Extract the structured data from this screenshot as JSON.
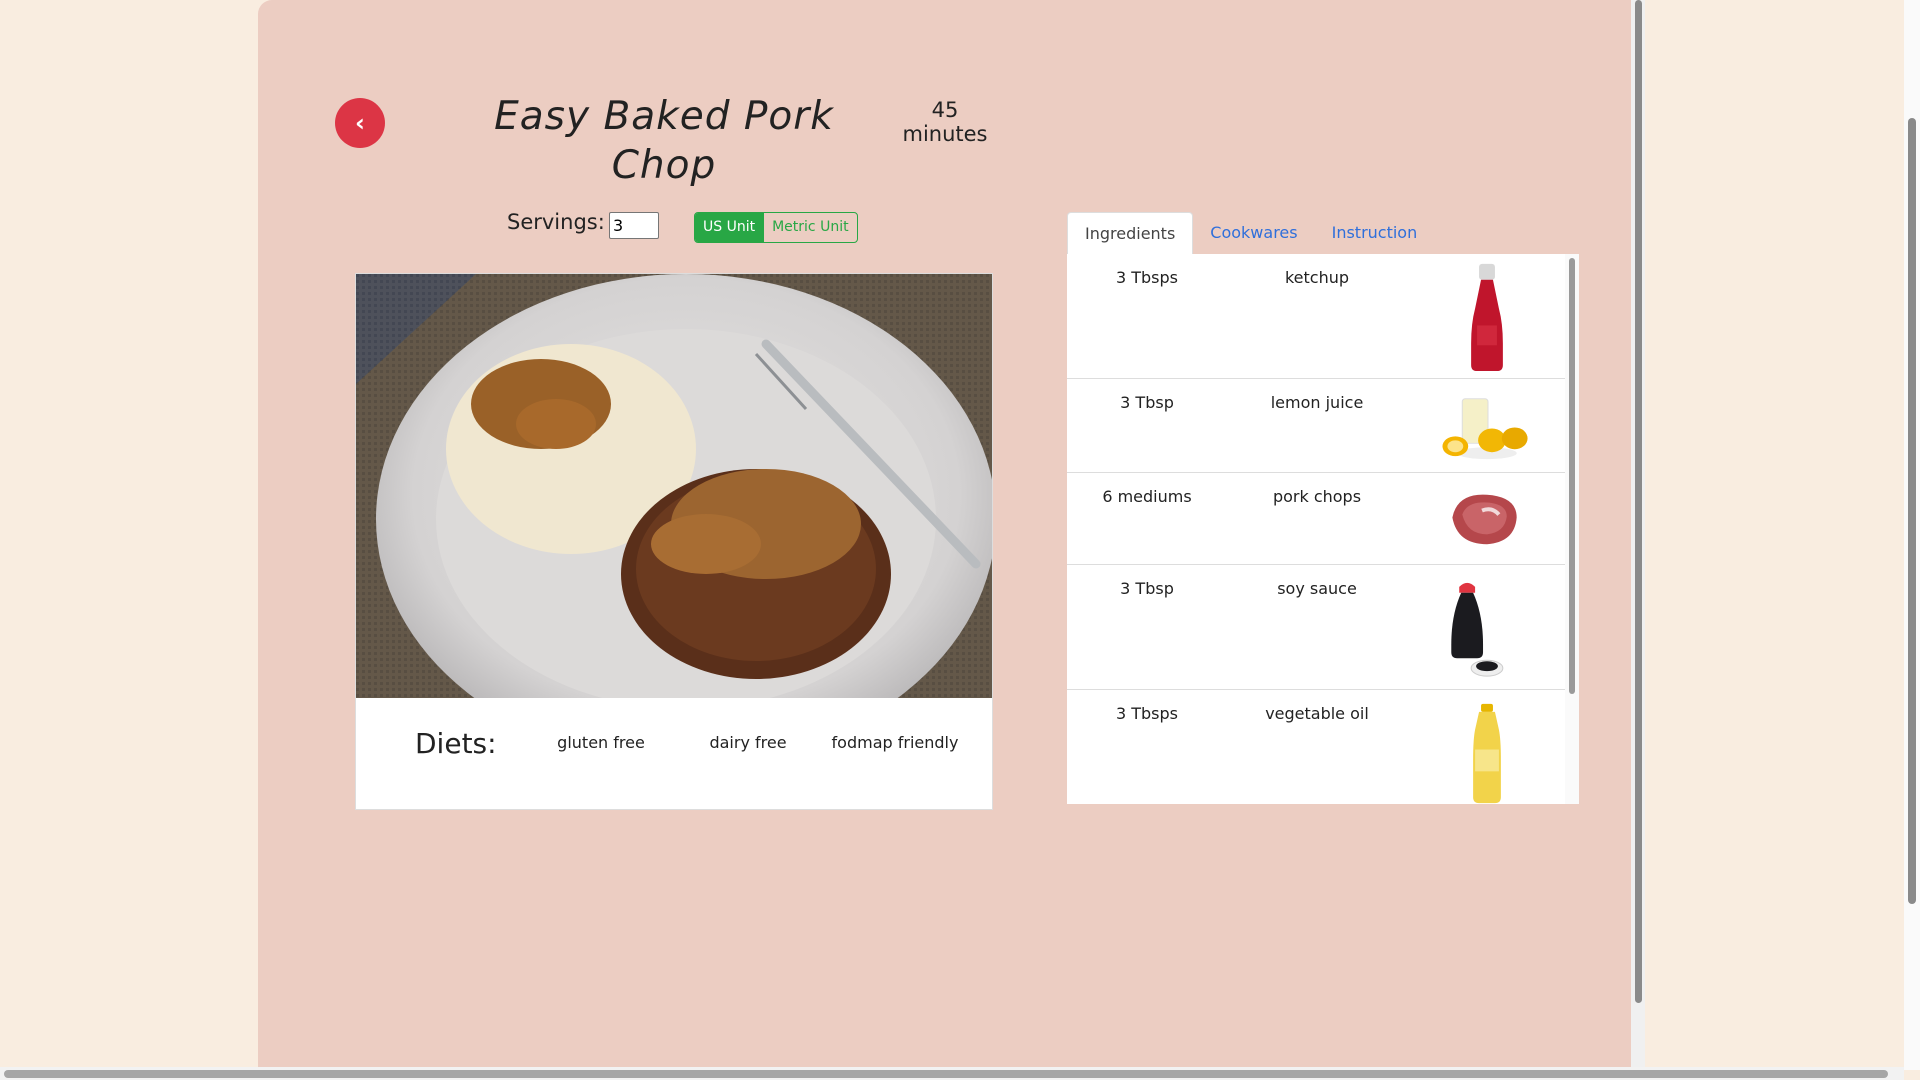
{
  "recipe": {
    "title": "Easy Baked Pork Chop",
    "time_value": "45",
    "time_unit": "minutes",
    "servings_label": "Servings:",
    "servings_value": "3"
  },
  "units": {
    "us_label": "US Unit",
    "metric_label": "Metric Unit",
    "selected": "US Unit"
  },
  "diets": {
    "label": "Diets:",
    "items": [
      "gluten free",
      "dairy free",
      "fodmap friendly"
    ]
  },
  "tabs": [
    "Ingredients",
    "Cookwares",
    "Instruction"
  ],
  "active_tab": "Ingredients",
  "ingredients": [
    {
      "qty": "3 Tbsps",
      "name": "ketchup",
      "icon": "ketchup-bottle-icon"
    },
    {
      "qty": "3 Tbsp",
      "name": "lemon juice",
      "icon": "lemon-juice-icon"
    },
    {
      "qty": "6 mediums",
      "name": "pork chops",
      "icon": "pork-chop-icon"
    },
    {
      "qty": "3 Tbsp",
      "name": "soy sauce",
      "icon": "soy-sauce-icon"
    },
    {
      "qty": "3 Tbsps",
      "name": "vegetable oil",
      "icon": "vegetable-oil-icon"
    }
  ],
  "colors": {
    "page_bg": "#f9ede0",
    "panel_bg": "#eccdc2",
    "back_button": "#dc3545",
    "unit_active": "#28a745",
    "tab_link": "#2f6fdb"
  }
}
